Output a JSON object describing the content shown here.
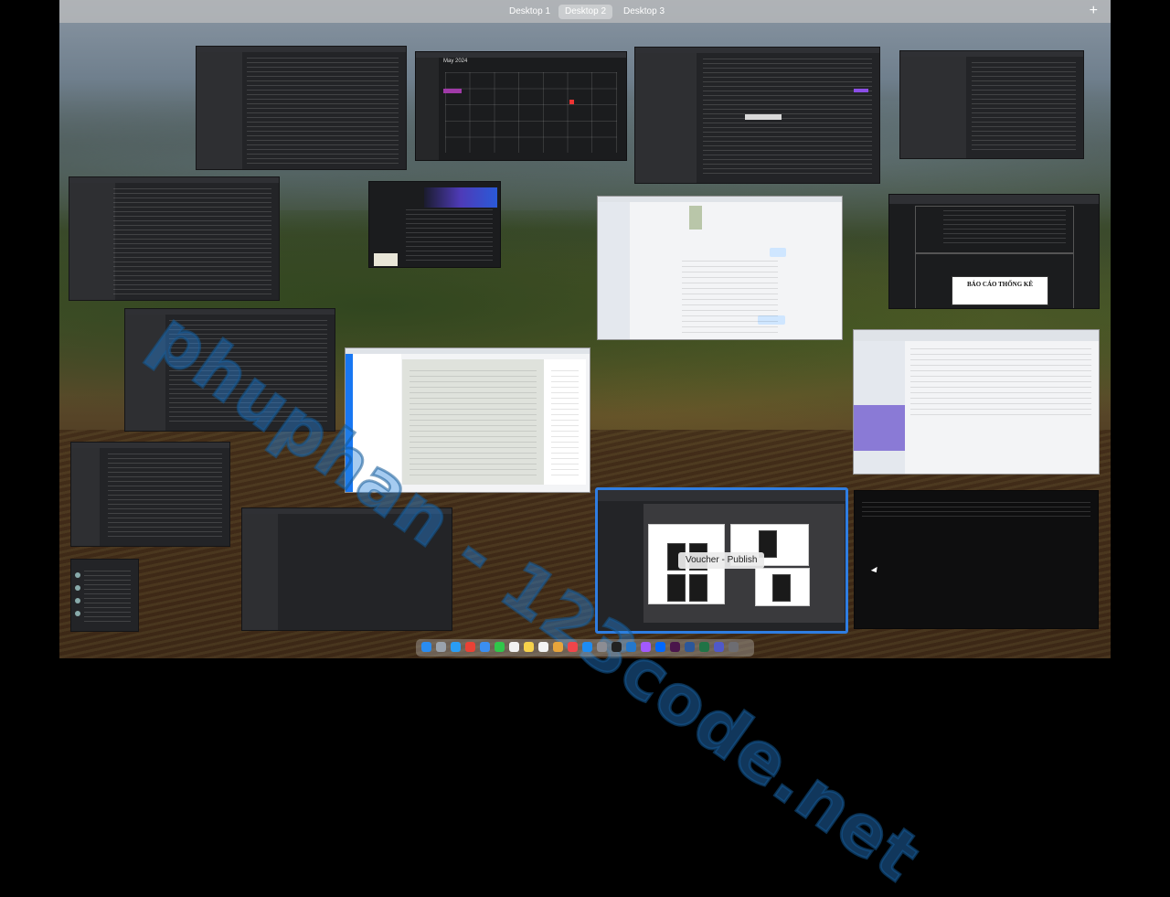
{
  "top_bar": {
    "desktops": [
      "Desktop 1",
      "Desktop 2",
      "Desktop 3"
    ],
    "active_desktop": "Desktop 2",
    "add_icon": "+"
  },
  "windows": {
    "calendar_month": "May 2024",
    "selected_window_tooltip": "Voucher - Publish",
    "report_box_label": "BÁO CÁO THỐNG KÊ"
  },
  "watermark_text": "phuphan - 123code.net",
  "dock": {
    "icon_names": [
      "finder-icon",
      "launchpad-icon",
      "safari-icon",
      "chrome-icon",
      "mail-icon",
      "messages-icon",
      "calendar-icon",
      "notes-icon",
      "reminders-icon",
      "photos-icon",
      "music-icon",
      "app-store-icon",
      "settings-icon",
      "terminal-icon",
      "vscode-icon",
      "figma-icon",
      "zalo-icon",
      "slack-icon",
      "word-icon",
      "excel-icon",
      "teams-icon",
      "trash-icon"
    ],
    "icon_colors": [
      "#2a8cf0",
      "#9aa3ad",
      "#2a9df4",
      "#e94235",
      "#3b8ef0",
      "#30c64a",
      "#f2f2f2",
      "#f6d24a",
      "#f3f3f3",
      "#e8a53b",
      "#f0454a",
      "#1d8cf2",
      "#8d8d93",
      "#222222",
      "#2478cc",
      "#a259ff",
      "#0068ff",
      "#4a154b",
      "#2b579a",
      "#217346",
      "#5059c9",
      "#6d6d72"
    ]
  }
}
